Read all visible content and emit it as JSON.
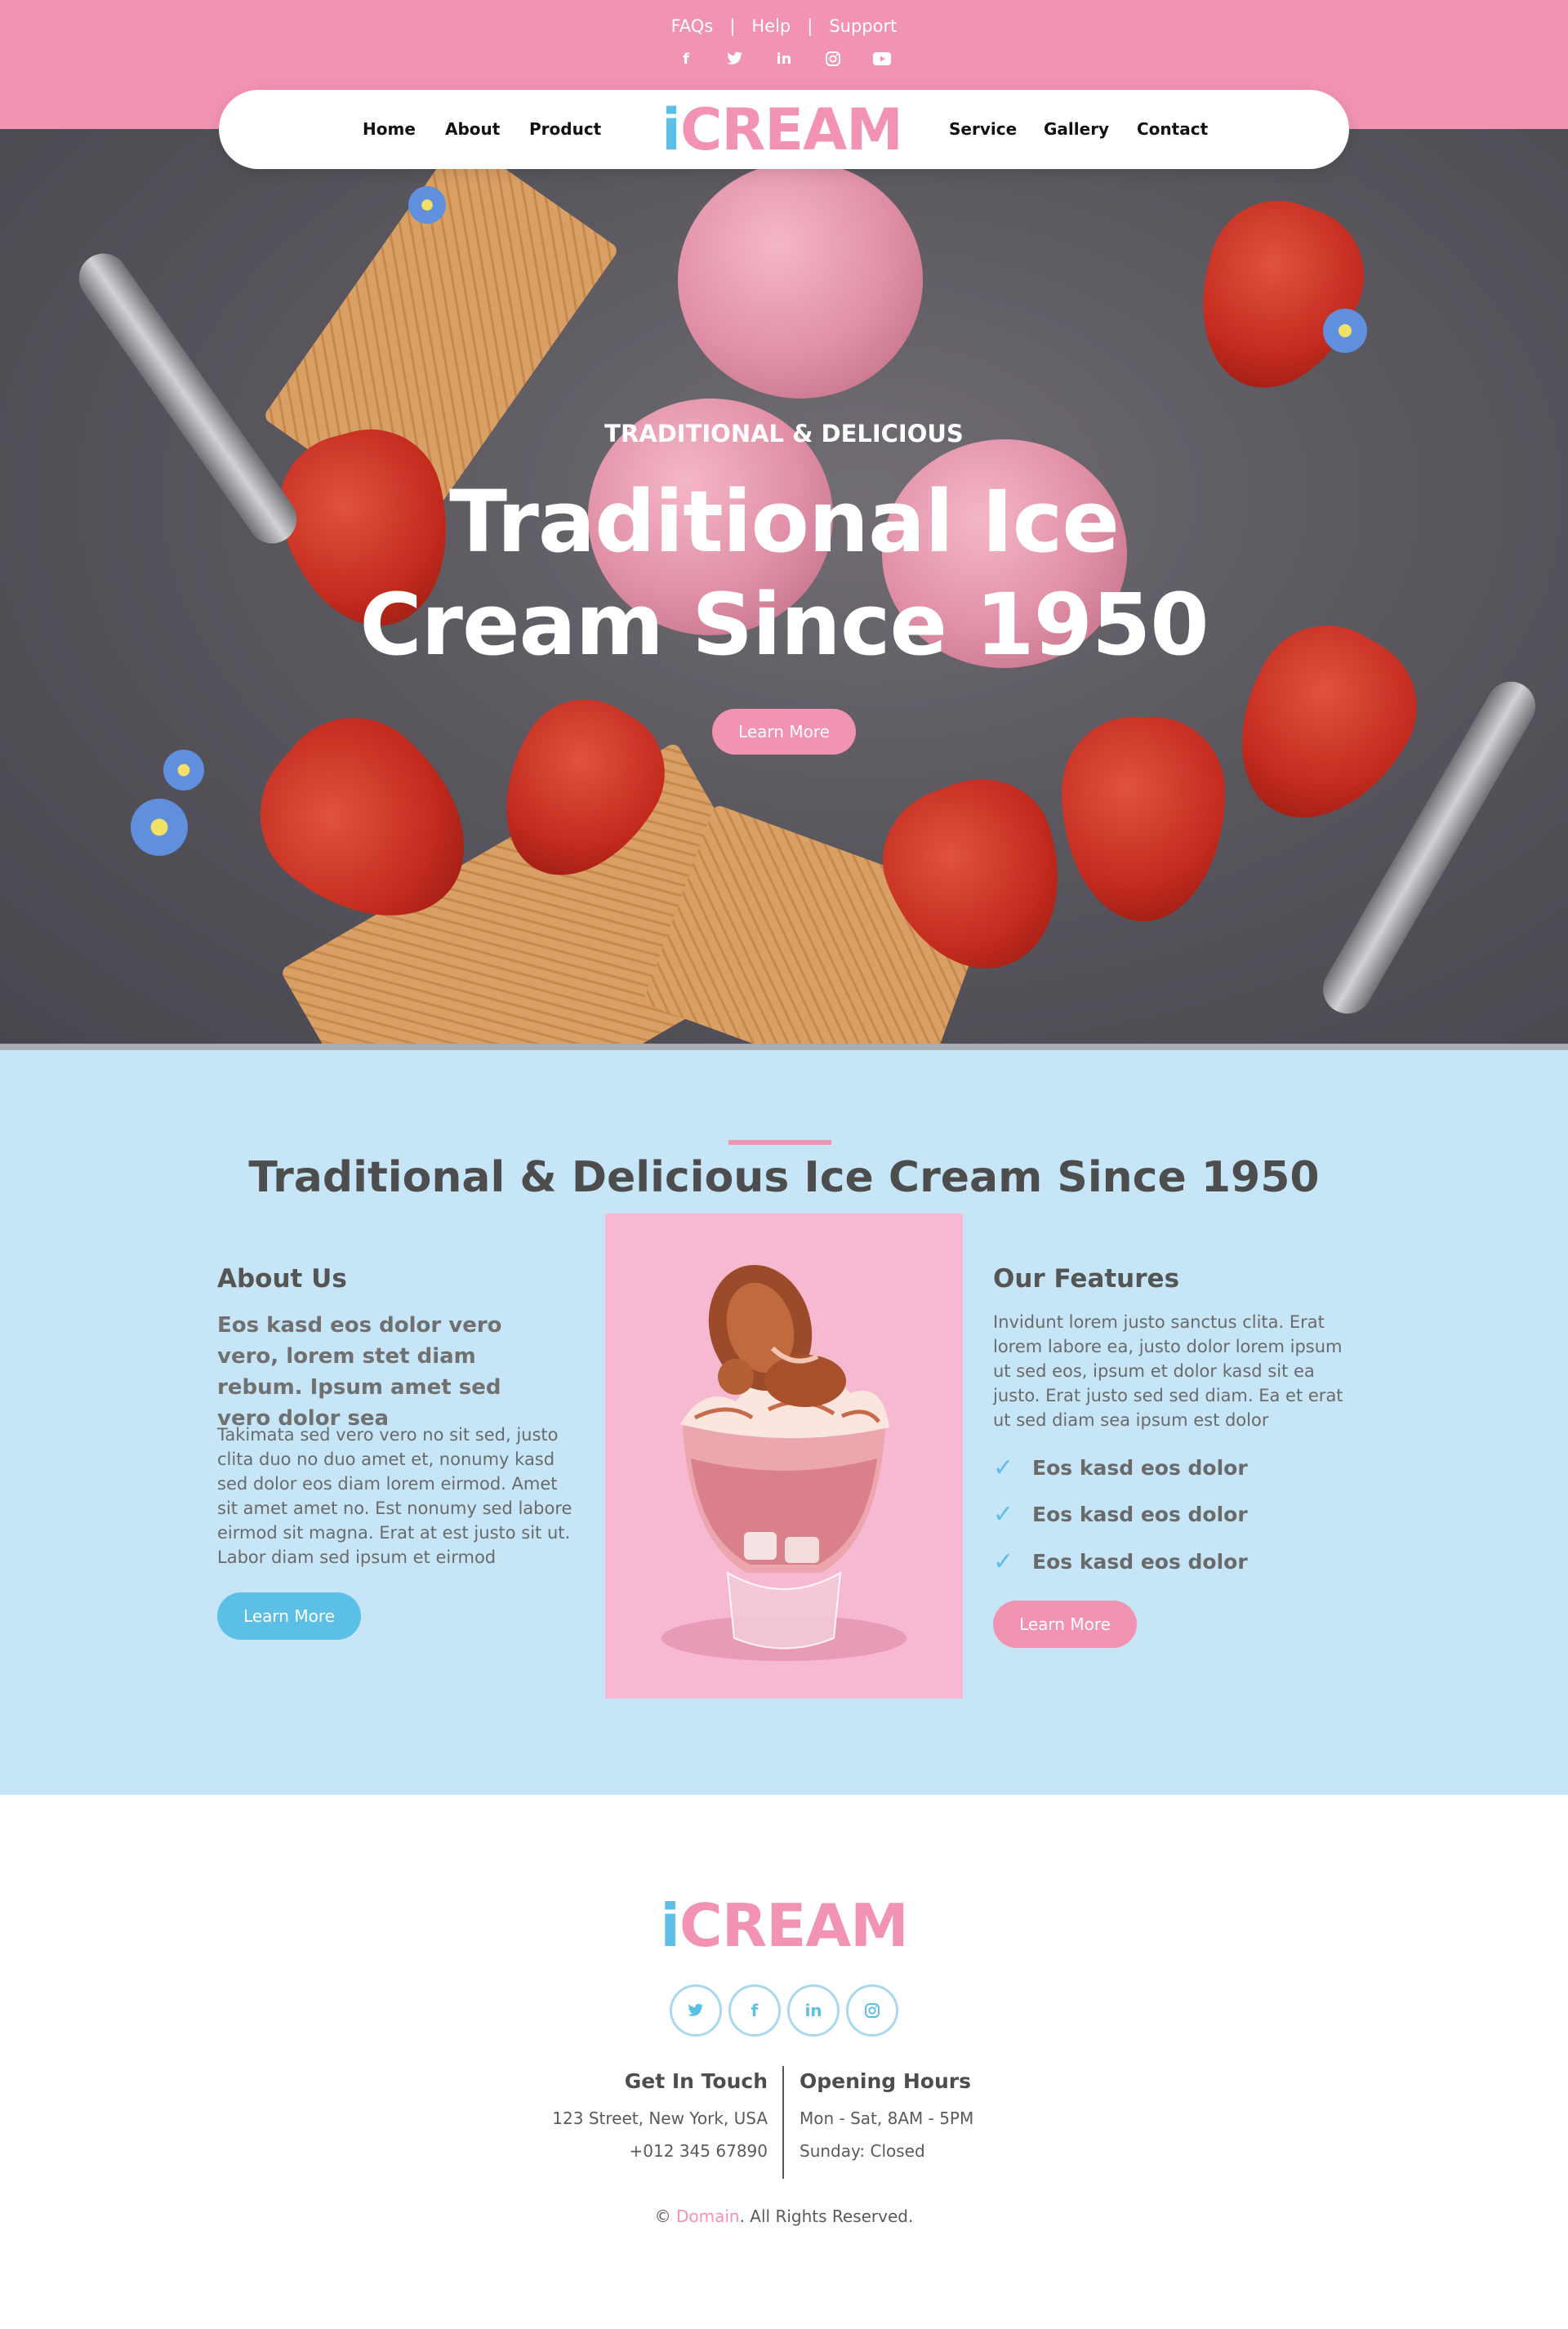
{
  "brand": {
    "logo_i": "i",
    "logo_rest": "CREAM"
  },
  "topbar": {
    "links": [
      "FAQs",
      "Help",
      "Support"
    ],
    "socials": [
      "facebook-icon",
      "twitter-icon",
      "linkedin-icon",
      "instagram-icon",
      "youtube-icon"
    ]
  },
  "nav": {
    "left": [
      "Home",
      "About",
      "Product"
    ],
    "right": [
      "Service",
      "Gallery",
      "Contact"
    ]
  },
  "hero": {
    "subtitle": "TRADITIONAL & DELICIOUS",
    "title_line1": "Traditional Ice",
    "title_line2": "Cream Since 1950",
    "button": "Learn More"
  },
  "about": {
    "title": "Traditional & Delicious Ice Cream Since 1950",
    "left": {
      "heading": "About Us",
      "lead": "Eos kasd eos dolor vero vero, lorem stet diam rebum. Ipsum amet sed vero dolor sea",
      "body": "Takimata sed vero vero no sit sed, justo clita duo no duo amet et, nonumy kasd sed dolor eos diam lorem eirmod. Amet sit amet amet no. Est nonumy sed labore eirmod sit magna. Erat at est justo sit ut. Labor diam sed ipsum et eirmod",
      "button": "Learn More"
    },
    "right": {
      "heading": "Our Features",
      "body": "Invidunt lorem justo sanctus clita. Erat lorem labore ea, justo dolor lorem ipsum ut sed eos, ipsum et dolor kasd sit ea justo. Erat justo sed sed diam. Ea et erat ut sed diam sea ipsum est dolor",
      "features": [
        "Eos kasd eos dolor",
        "Eos kasd eos dolor",
        "Eos kasd eos dolor"
      ],
      "button": "Learn More"
    }
  },
  "footer": {
    "socials": [
      "twitter-icon",
      "facebook-icon",
      "linkedin-icon",
      "instagram-icon"
    ],
    "contact": {
      "heading": "Get In Touch",
      "address": "123 Street, New York, USA",
      "phone": "+012 345 67890"
    },
    "hours": {
      "heading": "Opening Hours",
      "weekday": "Mon - Sat, 8AM - 5PM",
      "sunday": "Sunday: Closed"
    },
    "copyright_prefix": "© ",
    "copyright_domain": "Domain",
    "copyright_suffix": ". All Rights Reserved."
  },
  "colors": {
    "pink": "#f293b2",
    "blue": "#5cc0e6",
    "light_blue": "#c6e5f6"
  }
}
